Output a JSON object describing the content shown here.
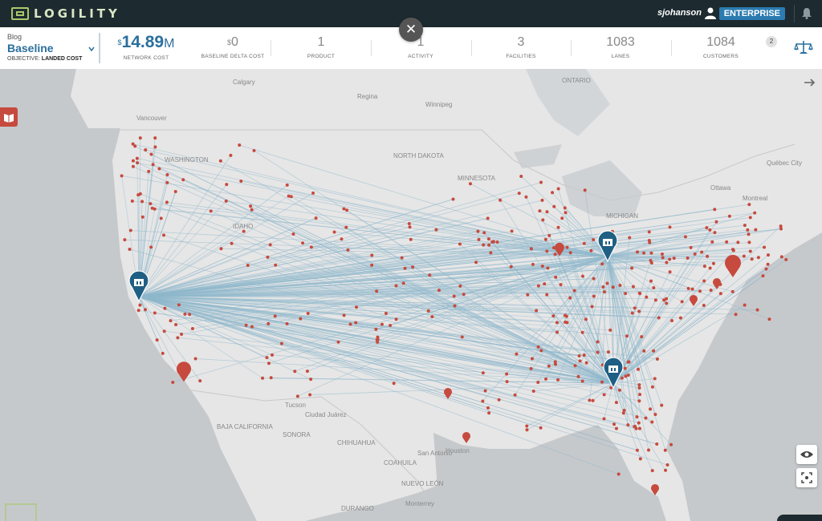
{
  "app": {
    "logo_text": "LOGILITY",
    "user": "sjohanson",
    "edition": "ENTERPRISE"
  },
  "scenario": {
    "folder": "Blog",
    "name": "Baseline",
    "objective_label": "OBJECTIVE:",
    "objective_value": "LANDED COST"
  },
  "kpis": {
    "network_cost": {
      "currency": "$",
      "value": "14.89",
      "unit": "M",
      "label": "NETWORK COST"
    },
    "baseline_delta": {
      "currency": "$",
      "value": "0",
      "label": "BASELINE DELTA COST"
    },
    "product": {
      "value": "1",
      "label": "PRODUCT"
    },
    "activity": {
      "value": "1",
      "label": "ACTIVITY"
    },
    "facilities": {
      "value": "3",
      "label": "FACILITIES"
    },
    "lanes": {
      "value": "1083",
      "label": "LANES"
    },
    "customers": {
      "value": "1084",
      "label": "CUSTOMERS"
    },
    "notification_count": "2"
  },
  "colors": {
    "topbar": "#1d2a30",
    "accent": "#2b6f9e",
    "customer_dot": "#c64a3e",
    "lane": "#8fb8cc",
    "facility": "#1f5f84"
  },
  "map": {
    "labels": [
      {
        "text": "ONTARIO"
      },
      {
        "text": "Winnipeg"
      },
      {
        "text": "Calgary"
      },
      {
        "text": "Regina"
      },
      {
        "text": "Vancouver"
      },
      {
        "text": "WASHINGTON"
      },
      {
        "text": "NORTH DAKOTA"
      },
      {
        "text": "MINNESOTA"
      },
      {
        "text": "Ottawa"
      },
      {
        "text": "Montreal"
      },
      {
        "text": "Québec City"
      },
      {
        "text": "IDAHO"
      },
      {
        "text": "SONORA"
      },
      {
        "text": "CHIHUAHUA"
      },
      {
        "text": "COAHUILA"
      },
      {
        "text": "NUEVO LEÓN"
      },
      {
        "text": "DURANGO"
      },
      {
        "text": "Monterrey"
      },
      {
        "text": "San Antonio"
      },
      {
        "text": "Houston"
      },
      {
        "text": "Ciudad Juárez"
      },
      {
        "text": "Tucson"
      },
      {
        "text": "BAJA CALIFORNIA"
      },
      {
        "text": "MICHIGAN"
      }
    ]
  },
  "icons": {
    "user": "user-icon",
    "notifications": "bell-icon",
    "close": "close-icon",
    "visibility": "eye-icon",
    "focus": "focus-icon",
    "side_panel": "book-icon",
    "optimize": "scale-icon"
  }
}
